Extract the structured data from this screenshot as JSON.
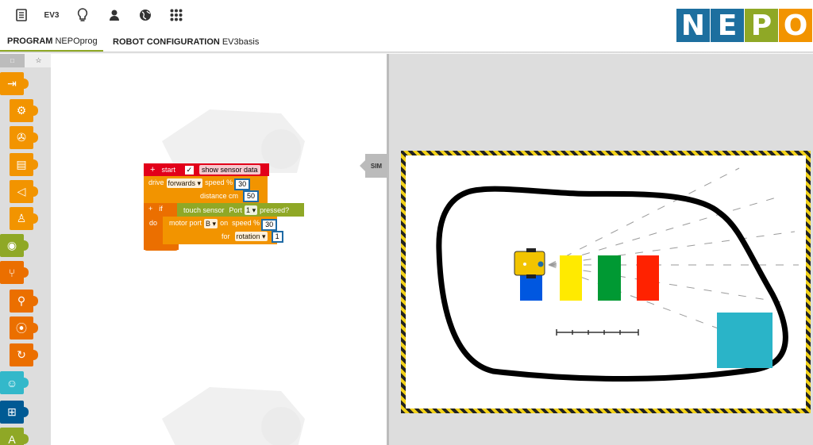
{
  "topbar": {
    "icons": [
      "document-icon",
      "ev3-icon",
      "lightbulb-icon",
      "user-icon",
      "globe-icon",
      "grid-icon"
    ],
    "ev3_label": "EV3",
    "logo_letters": [
      "N",
      "E",
      "P",
      "O"
    ],
    "logo_colors": [
      "#1d6f9f",
      "#1d6f9f",
      "#8fa826",
      "#f29400"
    ]
  },
  "tabs": {
    "program_label": "PROGRAM",
    "program_name": "NEPOprog",
    "config_label": "ROBOT CONFIGURATION",
    "config_name": "EV3basis"
  },
  "toolbox": {
    "tab1_icon": "□",
    "tab2_icon": "☆",
    "categories": [
      {
        "name": "action",
        "color": "#f29400",
        "glyph": "⇥"
      },
      {
        "name": "settings",
        "color": "#f29400",
        "glyph": "⚙"
      },
      {
        "name": "drive",
        "color": "#f29400",
        "glyph": "✇"
      },
      {
        "name": "display",
        "color": "#f29400",
        "glyph": "▤"
      },
      {
        "name": "sound",
        "color": "#f29400",
        "glyph": "◁"
      },
      {
        "name": "light",
        "color": "#f29400",
        "glyph": "♙"
      },
      {
        "name": "sensors",
        "color": "#8fa826",
        "glyph": "◉"
      },
      {
        "name": "control",
        "color": "#eb6f00",
        "glyph": "⑂"
      },
      {
        "name": "logic",
        "color": "#eb6f00",
        "glyph": "⚲"
      },
      {
        "name": "loops",
        "color": "#eb6f00",
        "glyph": "⦿"
      },
      {
        "name": "wait",
        "color": "#eb6f00",
        "glyph": "↻"
      },
      {
        "name": "math",
        "color": "#33b8ca",
        "glyph": "☺"
      },
      {
        "name": "variables",
        "color": "#005a94",
        "glyph": "⊞"
      },
      {
        "name": "text",
        "color": "#8fa826",
        "glyph": "A"
      }
    ]
  },
  "program": {
    "start_label": "start",
    "show_sensor_label": "show sensor data",
    "drive_label": "drive",
    "direction": "forwards",
    "speed_label": "speed %",
    "speed_value": "30",
    "distance_label": "distance cm",
    "distance_value": "50",
    "if_label": "if",
    "do_label": "do",
    "touch_label": "touch sensor",
    "port_label": "Port",
    "port_value": "1",
    "pressed_label": "pressed?",
    "motor_label": "motor port",
    "motor_port": "B",
    "on_label": "on",
    "motor_speed_label": "speed %",
    "motor_speed": "30",
    "for_label": "for",
    "rotation_unit": "rotation",
    "rotation_value": "1"
  },
  "sim": {
    "sim_label": "SIM",
    "blocks": [
      {
        "name": "blue",
        "color": "#0057e0"
      },
      {
        "name": "yellow",
        "color": "#ffea00"
      },
      {
        "name": "green",
        "color": "#009933"
      },
      {
        "name": "red",
        "color": "#ff2200"
      },
      {
        "name": "cyan",
        "color": "#2ab4c8"
      }
    ]
  }
}
